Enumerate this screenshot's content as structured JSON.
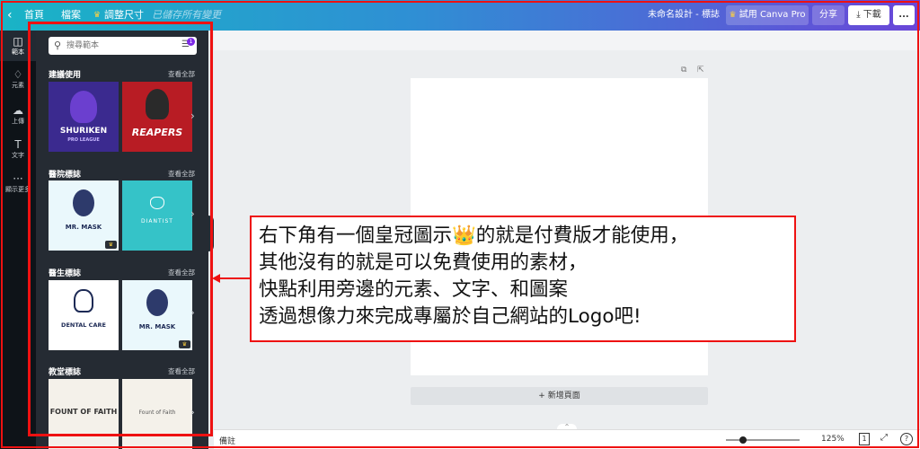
{
  "topbar": {
    "back_icon": "chevron-left-icon",
    "home": "首頁",
    "file": "檔案",
    "resize": "調整尺寸",
    "saved_status": "已儲存所有變更",
    "doc_title": "未命名設計 - 標誌",
    "try_pro": "試用 Canva Pro",
    "share": "分享",
    "download": "下載",
    "more": "..."
  },
  "rail": {
    "items": [
      {
        "label": "範本",
        "icon": "template-icon"
      },
      {
        "label": "元素",
        "icon": "elements-icon"
      },
      {
        "label": "上傳",
        "icon": "upload-icon"
      },
      {
        "label": "文字",
        "icon": "text-icon"
      },
      {
        "label": "顯示更多",
        "icon": "more-icon"
      }
    ]
  },
  "panel": {
    "search_placeholder": "搜尋範本",
    "filter_badge": "1",
    "see_all": "查看全部",
    "sections": [
      {
        "title": "建議使用",
        "thumbs": [
          {
            "text": "SHURIKEN",
            "sub": "PRO LEAGUE"
          },
          {
            "text": "REAPERS",
            "sub": ""
          }
        ]
      },
      {
        "title": "醫院標誌",
        "thumbs": [
          {
            "text": "MR. MASK",
            "sub": ""
          },
          {
            "text": "DIANTIST",
            "sub": ""
          }
        ]
      },
      {
        "title": "醫生標誌",
        "thumbs": [
          {
            "text": "DENTAL CARE",
            "sub": ""
          },
          {
            "text": "MR. MASK",
            "sub": ""
          }
        ]
      },
      {
        "title": "教堂標誌",
        "thumbs": [
          {
            "text": "FOUNT OF FAITH",
            "sub": ""
          },
          {
            "text": "Fount of Faith",
            "sub": ""
          }
        ]
      }
    ]
  },
  "canvas": {
    "add_page": "+ 新增頁面"
  },
  "bottombar": {
    "notes": "備註",
    "zoom": "125%",
    "page_count": "1",
    "help": "?"
  },
  "callout": {
    "lines": [
      "右下角有一個皇冠圖示👑的就是付費版才能使用，",
      "其他沒有的就是可以免費使用的素材，",
      "快點利用旁邊的元素、文字、和圖案",
      "透過想像力來完成專屬於自己網站的Logo吧!"
    ]
  },
  "colors": {
    "annotation_red": "#e11111",
    "topbar_start": "#19b4c6",
    "topbar_end": "#6a46d8",
    "panel_bg": "#252b33",
    "crown": "#ffd23f"
  }
}
